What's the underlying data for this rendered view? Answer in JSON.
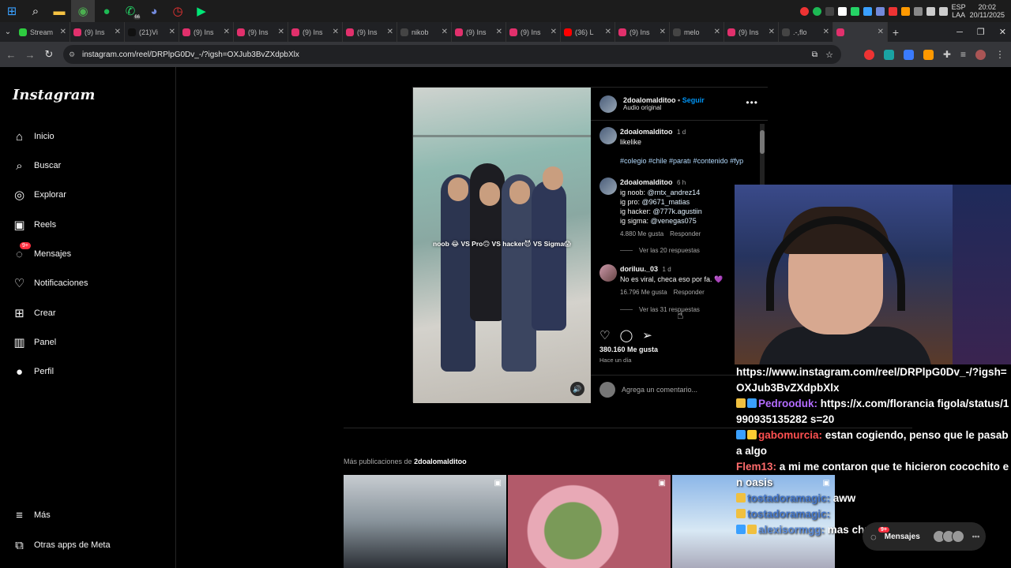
{
  "taskbar": {
    "apps": [
      "windows-icon",
      "search-icon",
      "folder-icon",
      "chrome-icon",
      "spotify-icon",
      "whatsapp-icon",
      "discord-icon",
      "clock-app-icon",
      "green-app-icon"
    ],
    "whatsapp_badge": "66",
    "lang_top": "ESP",
    "lang_bottom": "LAA",
    "time": "20:02",
    "date": "20/11/2025"
  },
  "tabs": [
    {
      "title": "Stream",
      "color": "#2ecc40",
      "icon": "streamlabs-icon"
    },
    {
      "title": "(9) Ins",
      "color": "#e1306c",
      "icon": "instagram-icon"
    },
    {
      "title": "(21)Vi",
      "color": "#111111",
      "icon": "tiktok-icon"
    },
    {
      "title": "(9) Ins",
      "color": "#e1306c",
      "icon": "instagram-icon"
    },
    {
      "title": "(9) Ins",
      "color": "#e1306c",
      "icon": "instagram-icon"
    },
    {
      "title": "(9) Ins",
      "color": "#e1306c",
      "icon": "instagram-icon"
    },
    {
      "title": "(9) Ins",
      "color": "#e1306c",
      "icon": "instagram-icon"
    },
    {
      "title": "nikob",
      "color": "#444444",
      "icon": "x-icon"
    },
    {
      "title": "(9) Ins",
      "color": "#e1306c",
      "icon": "instagram-icon"
    },
    {
      "title": "(9) Ins",
      "color": "#e1306c",
      "icon": "instagram-icon"
    },
    {
      "title": "(36) L",
      "color": "#ff0000",
      "icon": "youtube-icon"
    },
    {
      "title": "(9) Ins",
      "color": "#e1306c",
      "icon": "instagram-icon"
    },
    {
      "title": "melo",
      "color": "#444444",
      "icon": "x-icon"
    },
    {
      "title": "(9) Ins",
      "color": "#e1306c",
      "icon": "instagram-icon"
    },
    {
      "title": ".-,flo",
      "color": "#444444",
      "icon": "x-icon"
    },
    {
      "title": "",
      "color": "#e1306c",
      "icon": "instagram-icon"
    }
  ],
  "address": {
    "url": "instagram.com/reel/DRPlpG0Dv_-/?igsh=OXJub3BvZXdpbXlx"
  },
  "sidebar": {
    "logo": "Instagram",
    "items": [
      {
        "label": "Inicio",
        "icon": "home-icon",
        "glyph": "⌂"
      },
      {
        "label": "Buscar",
        "icon": "search-icon",
        "glyph": "⌕"
      },
      {
        "label": "Explorar",
        "icon": "compass-icon",
        "glyph": "◎"
      },
      {
        "label": "Reels",
        "icon": "reels-icon",
        "glyph": "▣"
      },
      {
        "label": "Mensajes",
        "icon": "messenger-icon",
        "glyph": "◌"
      },
      {
        "label": "Notificaciones",
        "icon": "heart-icon",
        "glyph": "♡"
      },
      {
        "label": "Crear",
        "icon": "plus-square-icon",
        "glyph": "⊞"
      },
      {
        "label": "Panel",
        "icon": "chart-icon",
        "glyph": "▥"
      },
      {
        "label": "Perfil",
        "icon": "profile-avatar",
        "glyph": "●"
      }
    ],
    "messages_badge": "9+",
    "bottom_items": [
      {
        "label": "Más",
        "icon": "menu-icon",
        "glyph": "≡"
      },
      {
        "label": "Otras apps de Meta",
        "icon": "meta-apps-icon",
        "glyph": "⧉"
      }
    ]
  },
  "post": {
    "video_caption": "noob 😂 VS Pro🙃 VS hacker😈 VS Sigma😱",
    "username": "2doalomalditoo",
    "follow": "Seguir",
    "separator": "•",
    "audio": "Audio original",
    "caption_user": "2doalomalditoo",
    "caption_time": "1 d",
    "caption_text": "likelike",
    "hashtags": "#colegio #chile #paratı #contenido #fyp",
    "comments": [
      {
        "user": "2doalomalditoo",
        "time": "6 h",
        "lines": [
          "ig noob: ",
          "ig pro: ",
          "ig hacker: ",
          "ig sigma: "
        ],
        "mentions": [
          "@rntx_andrez14",
          "@9671_matias",
          "@777k.agustiin",
          "@venegas075"
        ],
        "likes": "4.880 Me gusta",
        "reply": "Responder",
        "view_replies": "Ver las 20 respuestas"
      },
      {
        "user": "doriluu._03",
        "time": "1 d",
        "text": "No es viral, checa eso por fa. 💜",
        "likes": "16.796 Me gusta",
        "reply": "Responder",
        "view_replies": "Ver las 31 respuestas"
      }
    ],
    "like_count": "380.160 Me gusta",
    "posted": "Hace un día",
    "add_comment_placeholder": "Agrega un comentario..."
  },
  "more_posts": {
    "label": "Más publicaciones de ",
    "user": "2doalomalditoo"
  },
  "chat": {
    "messages": [
      {
        "user": "",
        "user_color": "#888888",
        "text": "https://www.instagram.com/reel/DRPlpG0Dv_-/?igsh=OXJub3BvZXdpbXlx",
        "badges": []
      },
      {
        "user": "Pedrooduk:",
        "user_color": "#b36bff",
        "text": "https://x.com/florancia figola/status/1990935135282 s=20",
        "badges": [
          "#f0c040",
          "#3aa0ff"
        ]
      },
      {
        "user": "gabomurcia:",
        "user_color": "#ff5050",
        "text": "estan cogiendo, penso que le pasaba algo",
        "badges": [
          "#3aa0ff",
          "#ffcc33"
        ]
      },
      {
        "user": "Flem13:",
        "user_color": "#ff6b6b",
        "text": "a mi me contaron que te hicieron cocochito en oasis",
        "badges": []
      },
      {
        "user": "tostadoramagic:",
        "user_color": "#4477cc",
        "text": "aww",
        "badges": [
          "#f0c040"
        ]
      },
      {
        "user": "tostadoramagic:",
        "user_color": "#4477cc",
        "text": "",
        "badges": [
          "#f0c040"
        ]
      },
      {
        "user": "alexisormgg:",
        "user_color": "#5a8ad8",
        "text": "mas chu",
        "badges": [
          "#3aa0ff",
          "#f0c040"
        ]
      }
    ]
  },
  "messages_float": {
    "label": "Mensajes",
    "badge": "9+"
  }
}
